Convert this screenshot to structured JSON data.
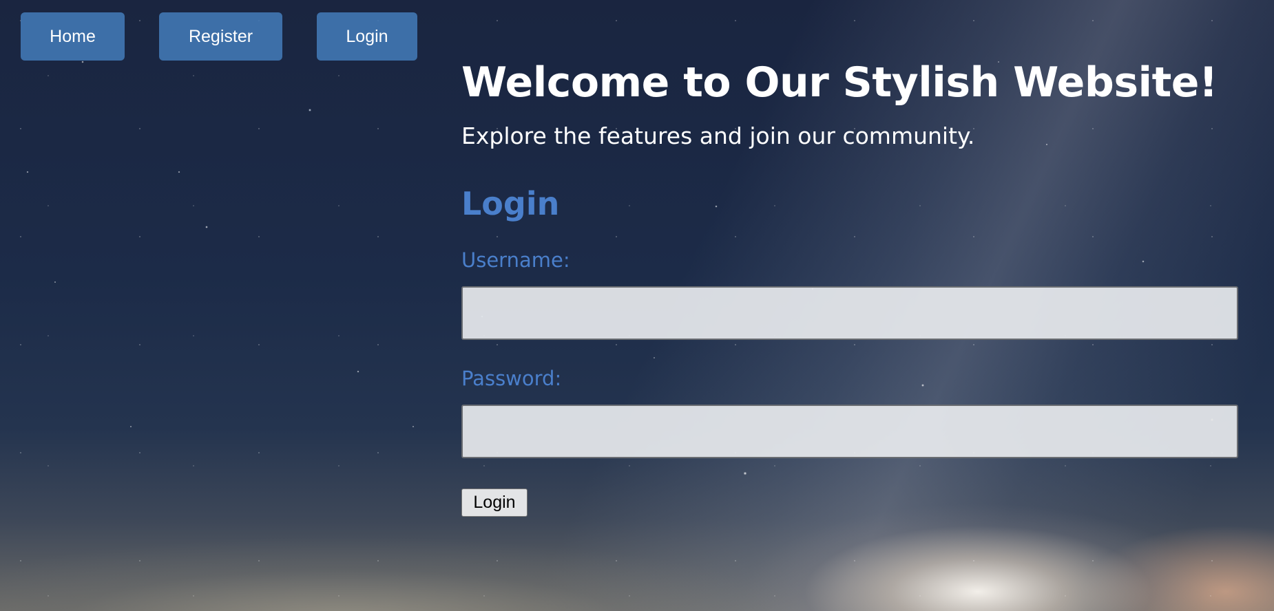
{
  "nav": {
    "items": [
      {
        "label": "Home"
      },
      {
        "label": "Register"
      },
      {
        "label": "Login"
      }
    ]
  },
  "hero": {
    "title": "Welcome to Our Stylish Website!",
    "subtitle": "Explore the features and join our community."
  },
  "login_form": {
    "title": "Login",
    "username_label": "Username:",
    "username_value": "",
    "password_label": "Password:",
    "password_value": "",
    "submit_label": "Login"
  },
  "colors": {
    "nav_button_bg": "#427ab6",
    "form_accent": "#4a7fcb",
    "heading_text": "#ffffff"
  }
}
